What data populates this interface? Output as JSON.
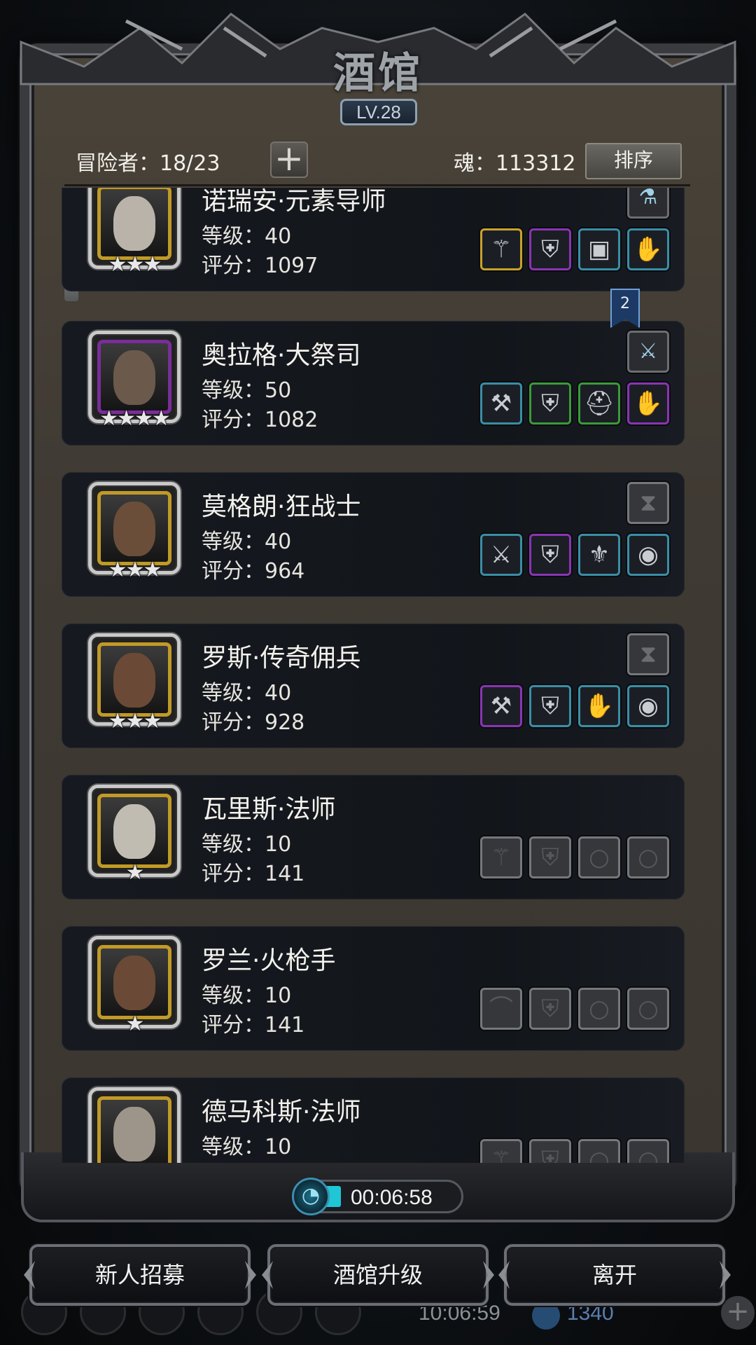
{
  "title": "酒馆",
  "level_badge": "LV.28",
  "header": {
    "adventurers": "冒险者：18/23",
    "soul": "魂：113312",
    "sort_label": "排序",
    "add_icon": "+"
  },
  "heroes": [
    {
      "name": "诺瑞安·元素导师",
      "level": "等级：40",
      "score": "评分：1097",
      "stars": "★★★",
      "frame": "gold",
      "slots": [
        {
          "color": "gold",
          "icon": "staff-icon",
          "glyph": "⚚"
        },
        {
          "color": "purple",
          "icon": "armor-icon",
          "glyph": "⛨"
        },
        {
          "color": "teal",
          "icon": "shoulder-icon",
          "glyph": "▣"
        },
        {
          "color": "teal",
          "icon": "gauntlet-icon",
          "glyph": "✋"
        }
      ],
      "top_slot": {
        "color": "grey",
        "icon": "potion-icon",
        "glyph": "⚗"
      }
    },
    {
      "name": "奥拉格·大祭司",
      "level": "等级：50",
      "score": "评分：1082",
      "stars": "★★★★",
      "frame": "purple",
      "slots": [
        {
          "color": "teal",
          "icon": "hammer-icon",
          "glyph": "⚒"
        },
        {
          "color": "green",
          "icon": "armor-icon",
          "glyph": "⛨"
        },
        {
          "color": "green",
          "icon": "helmet-icon",
          "glyph": "⛑"
        },
        {
          "color": "purple",
          "icon": "gauntlet-icon",
          "glyph": "✋"
        }
      ],
      "top_slot": {
        "color": "grey",
        "icon": "bracer-icon",
        "glyph": "⚔"
      }
    },
    {
      "name": "莫格朗·狂战士",
      "level": "等级：40",
      "score": "评分：964",
      "stars": "★★★",
      "frame": "gold",
      "slots": [
        {
          "color": "teal",
          "icon": "axe-icon",
          "glyph": "⚔"
        },
        {
          "color": "purple",
          "icon": "armor-icon",
          "glyph": "⛨"
        },
        {
          "color": "teal",
          "icon": "amulet-icon",
          "glyph": "⚜"
        },
        {
          "color": "teal",
          "icon": "ring-icon",
          "glyph": "◉"
        }
      ],
      "top_slot": {
        "color": "empty",
        "icon": "hourglass-icon",
        "glyph": "⧗"
      }
    },
    {
      "name": "罗斯·传奇佣兵",
      "level": "等级：40",
      "score": "评分：928",
      "stars": "★★★",
      "frame": "gold",
      "slots": [
        {
          "color": "purple",
          "icon": "scythe-icon",
          "glyph": "⚒"
        },
        {
          "color": "teal",
          "icon": "armor-icon",
          "glyph": "⛨"
        },
        {
          "color": "teal",
          "icon": "gauntlet-icon",
          "glyph": "✋"
        },
        {
          "color": "teal",
          "icon": "ring-icon",
          "glyph": "◉"
        }
      ],
      "top_slot": {
        "color": "empty",
        "icon": "hourglass-icon",
        "glyph": "⧗"
      }
    },
    {
      "name": "瓦里斯·法师",
      "level": "等级：10",
      "score": "评分：141",
      "stars": "★",
      "frame": "gold",
      "slots": [
        {
          "color": "empty",
          "icon": "staff-icon",
          "glyph": "⚚"
        },
        {
          "color": "empty",
          "icon": "armor-icon",
          "glyph": "⛨"
        },
        {
          "color": "empty",
          "icon": "ring-icon",
          "glyph": "○"
        },
        {
          "color": "empty",
          "icon": "ring-icon",
          "glyph": "○"
        }
      ]
    },
    {
      "name": "罗兰·火枪手",
      "level": "等级：10",
      "score": "评分：141",
      "stars": "★",
      "frame": "gold",
      "slots": [
        {
          "color": "empty",
          "icon": "gun-icon",
          "glyph": "⌒"
        },
        {
          "color": "empty",
          "icon": "armor-icon",
          "glyph": "⛨"
        },
        {
          "color": "empty",
          "icon": "ring-icon",
          "glyph": "○"
        },
        {
          "color": "empty",
          "icon": "ring-icon",
          "glyph": "○"
        }
      ]
    },
    {
      "name": "德马科斯·法师",
      "level": "等级：10",
      "score": "",
      "stars": "",
      "frame": "gold",
      "slots": [
        {
          "color": "empty",
          "icon": "staff-icon",
          "glyph": "⚚"
        },
        {
          "color": "empty",
          "icon": "armor-icon",
          "glyph": "⛨"
        },
        {
          "color": "empty",
          "icon": "ring-icon",
          "glyph": "○"
        },
        {
          "color": "empty",
          "icon": "ring-icon",
          "glyph": "○"
        }
      ]
    }
  ],
  "bookmark": "2",
  "timer": "00:06:58",
  "buttons": {
    "recruit": "新人招募",
    "upgrade": "酒馆升级",
    "leave": "离开"
  },
  "background": {
    "clock": "10:06:59",
    "gems": "1340"
  }
}
